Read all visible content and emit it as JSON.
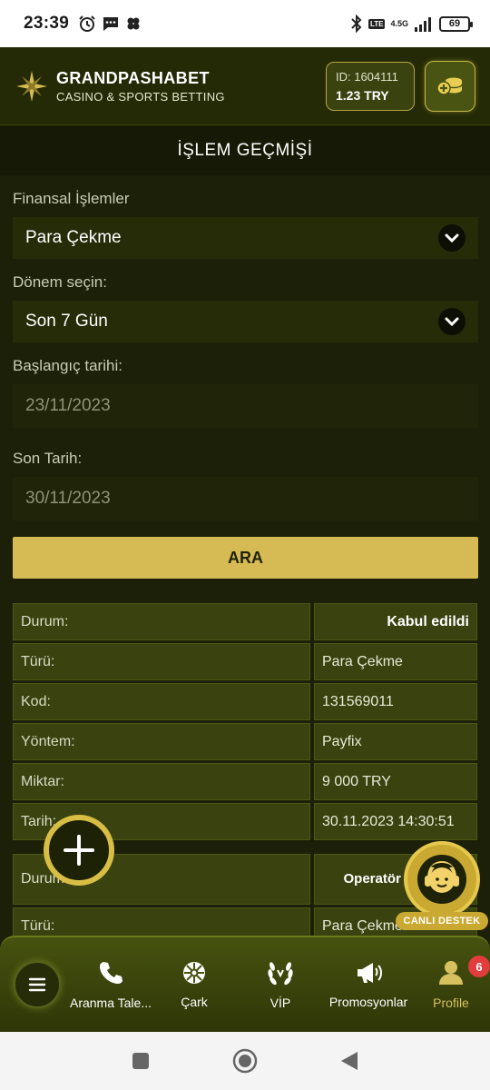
{
  "status_bar": {
    "time": "23:39",
    "network": "4.5G",
    "lte": "LTE",
    "battery": "69"
  },
  "header": {
    "brand": "GRANDPASHABET",
    "tagline": "CASINO & SPORTS BETTING",
    "account_id": "ID: 1604111",
    "balance": "1.23 TRY",
    "accent_color": "#d6bb55"
  },
  "page_title": "İŞLEM GEÇMİŞİ",
  "form": {
    "category_label": "Finansal İşlemler",
    "category_value": "Para Çekme",
    "period_label": "Dönem seçin:",
    "period_value": "Son 7 Gün",
    "start_label": "Başlangıç tarihi:",
    "start_value": "23/11/2023",
    "end_label": "Son Tarih:",
    "end_value": "30/11/2023",
    "search_button": "ARA"
  },
  "transactions": [
    {
      "rows": [
        {
          "key": "Durum:",
          "value": "Kabul edildi"
        },
        {
          "key": "Türü:",
          "value": "Para Çekme"
        },
        {
          "key": "Kod:",
          "value": "131569011"
        },
        {
          "key": "Yöntem:",
          "value": "Payfix"
        },
        {
          "key": "Miktar:",
          "value": "9 000 TRY"
        },
        {
          "key": "Tarih:",
          "value": "30.11.2023 14:30:51"
        }
      ]
    },
    {
      "rows": [
        {
          "key": "Durum:",
          "value": "Operatör t... ip..."
        },
        {
          "key": "Türü:",
          "value": "Para Çekme"
        }
      ]
    }
  ],
  "support": {
    "label": "CANLI DESTEK"
  },
  "bottom_nav": {
    "items": [
      {
        "label": "Aranma Tale...",
        "icon": "phone-icon"
      },
      {
        "label": "Çark",
        "icon": "wheel-icon"
      },
      {
        "label": "VİP",
        "icon": "laurel-icon"
      },
      {
        "label": "Promosyonlar",
        "icon": "megaphone-icon"
      },
      {
        "label": "Profile",
        "icon": "user-icon",
        "badge": "6"
      }
    ]
  }
}
